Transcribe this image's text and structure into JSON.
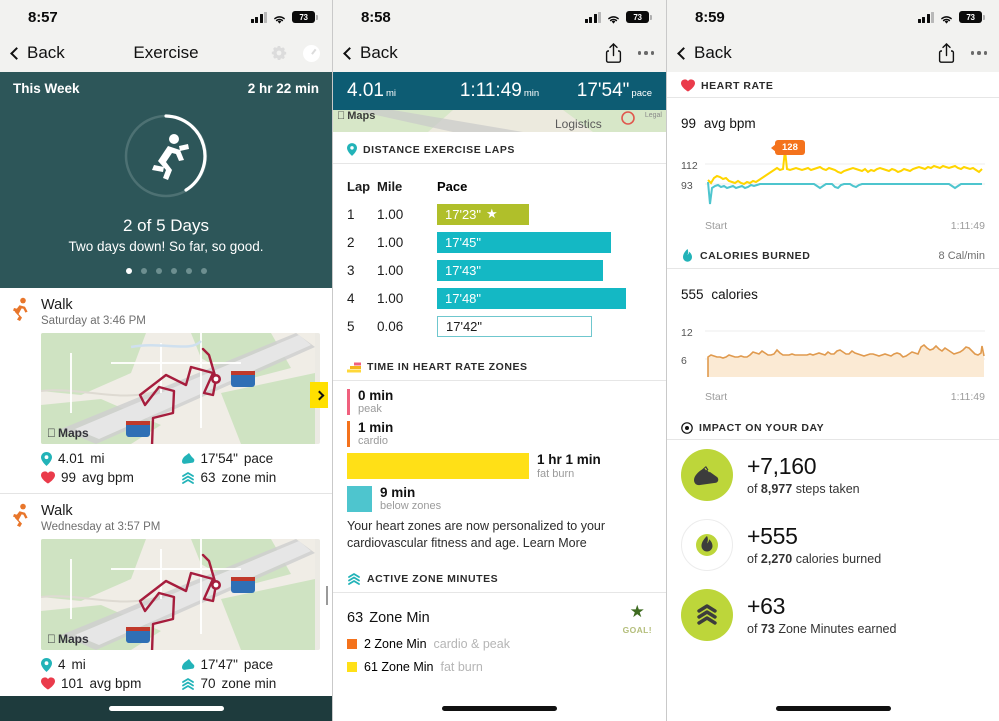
{
  "screen1": {
    "status": {
      "time": "8:57",
      "battery": "73"
    },
    "nav": {
      "back": "Back",
      "title": "Exercise",
      "gear": "gear-icon",
      "timer": "stopwatch-icon"
    },
    "hero": {
      "week_label": "This Week",
      "week_total": "2 hr 22 min",
      "days": "2 of 5 Days",
      "message": "Two days down! So far, so good.",
      "dots_total": 6,
      "dots_active": 0,
      "ring_icon": "running-person-icon"
    },
    "activities": [
      {
        "title": "Walk",
        "date": "Saturday at 3:46 PM",
        "map_label": "Maps",
        "stats": [
          {
            "icon": "pin-icon",
            "value": "4.01",
            "unit": "mi"
          },
          {
            "icon": "heart-icon",
            "value": "17'54\"",
            "unit": "pace"
          },
          {
            "icon": "heart-icon",
            "value": "99",
            "unit": "avg bpm"
          },
          {
            "icon": "zone-icon",
            "value": "63",
            "unit": "zone min"
          }
        ],
        "chevron_highlight": true
      },
      {
        "title": "Walk",
        "date": "Wednesday at 3:57 PM",
        "map_label": "Maps",
        "stats": [
          {
            "icon": "pin-icon",
            "value": "4",
            "unit": "mi"
          },
          {
            "icon": "shoe-icon",
            "value": "17'47\"",
            "unit": "pace"
          },
          {
            "icon": "heart-icon",
            "value": "101",
            "unit": "avg bpm"
          },
          {
            "icon": "zone-icon",
            "value": "70",
            "unit": "zone min"
          }
        ],
        "chevron_highlight": false
      }
    ]
  },
  "screen2": {
    "status": {
      "time": "8:58",
      "battery": "73"
    },
    "nav": {
      "back": "Back",
      "share": "share-icon",
      "more": "more-icon"
    },
    "summary": [
      {
        "value": "4.01",
        "unit": "mi"
      },
      {
        "value": "1:11:49",
        "unit": "min"
      },
      {
        "value": "17'54\"",
        "unit": "pace"
      }
    ],
    "map_strip": {
      "maps_label": "Maps",
      "poi": "Logistics",
      "legal": "Legal"
    },
    "laps_section": {
      "title": "DISTANCE EXERCISE LAPS",
      "icon": "pin-icon",
      "columns": [
        "Lap",
        "Mile",
        "Pace"
      ],
      "rows": [
        {
          "lap": "1",
          "mile": "1.00",
          "pace": "17'23\"",
          "width": 43,
          "style": "best",
          "star": "★"
        },
        {
          "lap": "2",
          "mile": "1.00",
          "pace": "17'45\"",
          "width": 81,
          "style": "norm",
          "star": ""
        },
        {
          "lap": "3",
          "mile": "1.00",
          "pace": "17'43\"",
          "width": 77,
          "style": "norm",
          "star": ""
        },
        {
          "lap": "4",
          "mile": "1.00",
          "pace": "17'48\"",
          "width": 88,
          "style": "norm",
          "star": ""
        },
        {
          "lap": "5",
          "mile": "0.06",
          "pace": "17'42\"",
          "width": 72,
          "style": "open",
          "star": ""
        }
      ]
    },
    "zones_section": {
      "title": "TIME IN HEART RATE ZONES",
      "icon": "bars-icon",
      "rows": [
        {
          "time": "0 min",
          "name": "peak",
          "color": "#f0607e",
          "width": 3
        },
        {
          "time": "1 min",
          "name": "cardio",
          "color": "#f4721c",
          "width": 3
        },
        {
          "time": "1 hr 1 min",
          "name": "fat burn",
          "color": "#ffe017",
          "width": 182
        },
        {
          "time": "9 min",
          "name": "below zones",
          "color": "#4ec5ce",
          "width": 25
        }
      ],
      "note": "Your heart zones are now personalized to your cardiovascular fitness and age. Learn More"
    },
    "azm_section": {
      "title": "ACTIVE ZONE MINUTES",
      "icon": "zone-icon",
      "total": "63",
      "total_unit": "Zone Min",
      "goal_star": "★",
      "goal_label": "GOAL!",
      "legend": [
        {
          "color": "#f4721c",
          "value": "2 Zone Min",
          "name": "cardio & peak"
        },
        {
          "color": "#ffe017",
          "value": "61 Zone Min",
          "name": "fat burn"
        }
      ]
    }
  },
  "screen3": {
    "status": {
      "time": "8:59",
      "battery": "73"
    },
    "nav": {
      "back": "Back",
      "share": "share-icon",
      "more": "more-icon"
    },
    "hr_section": {
      "title": "HEART RATE",
      "icon": "heart-icon",
      "value": "99",
      "unit": "avg bpm",
      "axis_high": "112",
      "axis_low": "93",
      "peak_label": "128",
      "start_label": "Start",
      "end_label": "1:11:49"
    },
    "cal_section": {
      "title": "CALORIES BURNED",
      "icon": "flame-icon",
      "rate": "8 Cal/min",
      "value": "555",
      "unit": "calories",
      "axis_high": "12",
      "axis_low": "6",
      "start_label": "Start",
      "end_label": "1:11:49"
    },
    "impact_section": {
      "title": "IMPACT ON YOUR DAY",
      "icon": "target-icon",
      "rows": [
        {
          "icon": "shoe-icon",
          "delta": "+7,160",
          "of": "of",
          "total": "8,977",
          "label": "steps taken",
          "filled": true
        },
        {
          "icon": "flame-icon",
          "delta": "+555",
          "of": "of",
          "total": "2,270",
          "label": "calories burned",
          "filled": false
        },
        {
          "icon": "zone-icon",
          "delta": "+63",
          "of": "of",
          "total": "73",
          "label": "Zone Minutes earned",
          "filled": true
        }
      ]
    }
  },
  "chart_data": [
    {
      "type": "line",
      "title": "HEART RATE",
      "ylabel": "bpm",
      "xlabel": "time",
      "ylim": [
        80,
        132
      ],
      "yticks": [
        93,
        112
      ],
      "xticks": [
        "Start",
        "1:11:49"
      ],
      "annotations": [
        {
          "label": "128",
          "x": 0.195,
          "y": 128
        }
      ],
      "series": [
        {
          "name": "heart rate",
          "color": "#ffd500",
          "values": [
            86,
            79,
            95,
            97,
            96,
            94,
            95,
            92,
            91,
            90,
            92,
            90,
            89,
            91,
            90,
            92,
            91,
            90,
            92,
            94,
            96,
            98,
            99,
            101,
            99,
            100,
            128,
            99,
            100,
            101,
            100,
            99,
            101,
            100,
            99,
            100,
            102,
            100,
            99,
            98,
            100,
            101,
            99,
            98,
            100,
            99,
            96,
            95,
            97,
            99,
            100,
            99,
            98,
            97,
            99,
            96,
            98,
            97,
            99,
            100,
            99,
            98,
            97,
            99,
            98,
            96,
            97,
            99,
            98,
            97,
            99,
            100,
            101,
            100,
            99,
            101,
            100,
            102,
            101,
            100,
            102,
            101,
            100,
            101,
            102,
            100,
            99,
            101,
            100,
            99,
            100,
            101,
            100,
            99,
            98,
            100,
            99,
            101,
            100,
            99,
            100
          ]
        },
        {
          "name": "below zones",
          "color": "#4ec5ce",
          "values": [
            86,
            79,
            92,
            90,
            89,
            88,
            90,
            91,
            88,
            87,
            89,
            90,
            91,
            88,
            90,
            91,
            92,
            90,
            91,
            92,
            93,
            93,
            93,
            93,
            93,
            93,
            93,
            93,
            93,
            93,
            93,
            93,
            93,
            93,
            93,
            93,
            93,
            93,
            93,
            93,
            93,
            93,
            93,
            93,
            91,
            90,
            92,
            93,
            93,
            93,
            91,
            90,
            93,
            93,
            93,
            92,
            90,
            93,
            93,
            93,
            93,
            93,
            93,
            93,
            93,
            93,
            93,
            93,
            93,
            93,
            93,
            93,
            93,
            93,
            93,
            93,
            93,
            93,
            93,
            93,
            93,
            93,
            93,
            93,
            93,
            93,
            93,
            93,
            93,
            93,
            93,
            93,
            93,
            93,
            91,
            90,
            92,
            93,
            93,
            93,
            93
          ]
        }
      ]
    },
    {
      "type": "area",
      "title": "CALORIES BURNED",
      "ylabel": "Cal/min",
      "xlabel": "time",
      "ylim": [
        0,
        14
      ],
      "yticks": [
        6,
        12
      ],
      "xticks": [
        "Start",
        "1:11:49"
      ],
      "series": [
        {
          "name": "calories per minute",
          "color": "#e09a4e",
          "values": [
            2.0,
            6.8,
            6.6,
            6.4,
            6.3,
            6.2,
            6.3,
            6.8,
            6.6,
            6.4,
            6.3,
            6.5,
            6.4,
            6.3,
            6.6,
            7.2,
            7.0,
            6.9,
            7.5,
            7.0,
            6.8,
            6.7,
            6.9,
            7.6,
            7.1,
            6.8,
            6.7,
            6.8,
            6.9,
            6.8,
            6.7,
            6.8,
            6.9,
            6.8,
            6.7,
            6.9,
            6.8,
            6.9,
            7.0,
            6.9,
            6.8,
            7.3,
            7.0,
            6.9,
            7.4,
            7.6,
            7.3,
            7.0,
            6.9,
            7.4,
            7.1,
            6.9,
            6.7,
            6.6,
            6.8,
            7.0,
            6.9,
            6.7,
            6.5,
            6.7,
            7.0,
            6.9,
            6.7,
            6.5,
            6.8,
            7.1,
            6.9,
            6.4,
            6.6,
            6.9,
            7.2,
            7.0,
            6.8,
            8.2,
            8.6,
            8.0,
            7.6,
            7.9,
            8.3,
            7.7,
            7.4,
            8.0,
            7.6,
            7.2,
            6.8,
            7.0,
            7.3,
            7.0,
            6.8,
            7.2,
            7.6,
            8.2,
            8.0,
            7.5,
            7.0,
            6.8,
            7.1,
            6.9,
            7.4,
            8.3,
            6.6
          ]
        }
      ]
    }
  ]
}
